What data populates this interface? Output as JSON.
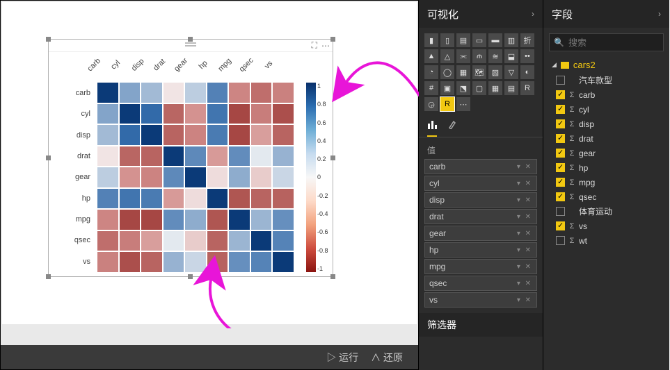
{
  "panes": {
    "viz_title": "可视化",
    "fields_title": "字段",
    "search_placeholder": "搜索",
    "values_label": "值",
    "filters_label": "筛选器"
  },
  "bottom_bar": {
    "run": "运行",
    "revert": "还原"
  },
  "table_name": "cars2",
  "value_items": [
    "carb",
    "cyl",
    "disp",
    "drat",
    "gear",
    "hp",
    "mpg",
    "qsec",
    "vs"
  ],
  "fields": [
    {
      "label": "汽车款型",
      "checked": false,
      "sigma": false
    },
    {
      "label": "carb",
      "checked": true,
      "sigma": true
    },
    {
      "label": "cyl",
      "checked": true,
      "sigma": true
    },
    {
      "label": "disp",
      "checked": true,
      "sigma": true
    },
    {
      "label": "drat",
      "checked": true,
      "sigma": true
    },
    {
      "label": "gear",
      "checked": true,
      "sigma": true
    },
    {
      "label": "hp",
      "checked": true,
      "sigma": true
    },
    {
      "label": "mpg",
      "checked": true,
      "sigma": true
    },
    {
      "label": "qsec",
      "checked": true,
      "sigma": true
    },
    {
      "label": "体育运动",
      "checked": false,
      "sigma": false
    },
    {
      "label": "vs",
      "checked": true,
      "sigma": true
    },
    {
      "label": "wt",
      "checked": false,
      "sigma": true
    }
  ],
  "chart_data": {
    "type": "heatmap",
    "title": "",
    "x_categories": [
      "carb",
      "cyl",
      "disp",
      "drat",
      "gear",
      "hp",
      "mpg",
      "qsec",
      "vs"
    ],
    "y_categories": [
      "carb",
      "cyl",
      "disp",
      "drat",
      "gear",
      "hp",
      "mpg",
      "qsec",
      "vs"
    ],
    "zlim": [
      -1,
      1
    ],
    "colorbar_ticks": [
      "1",
      "0.8",
      "0.6",
      "0.4",
      "0.2",
      "0",
      "-0.2",
      "-0.4",
      "-0.6",
      "-0.8",
      "-1"
    ],
    "matrix": [
      [
        1.0,
        0.53,
        0.39,
        -0.09,
        0.27,
        0.75,
        -0.55,
        -0.66,
        -0.57
      ],
      [
        0.53,
        1.0,
        0.9,
        -0.7,
        -0.49,
        0.83,
        -0.85,
        -0.59,
        -0.81
      ],
      [
        0.39,
        0.9,
        1.0,
        -0.71,
        -0.56,
        0.79,
        -0.85,
        -0.43,
        -0.71
      ],
      [
        -0.09,
        -0.7,
        -0.71,
        1.0,
        0.7,
        -0.45,
        0.68,
        0.09,
        0.44
      ],
      [
        0.27,
        -0.49,
        -0.56,
        0.7,
        1.0,
        -0.13,
        0.48,
        -0.21,
        0.21
      ],
      [
        0.75,
        0.83,
        0.79,
        -0.45,
        -0.13,
        1.0,
        -0.78,
        -0.71,
        -0.72
      ],
      [
        -0.55,
        -0.85,
        -0.85,
        0.68,
        0.48,
        -0.78,
        1.0,
        0.42,
        0.66
      ],
      [
        -0.66,
        -0.59,
        -0.43,
        0.09,
        -0.21,
        -0.71,
        0.42,
        1.0,
        0.74
      ],
      [
        -0.57,
        -0.81,
        -0.71,
        0.44,
        0.21,
        -0.72,
        0.66,
        0.74,
        1.0
      ]
    ]
  },
  "viz_icons": [
    "bar-stacked",
    "bar-clustered",
    "bar-100",
    "bar-h-stacked",
    "bar-h-clustered",
    "bar-h-100",
    "line",
    "area",
    "area-stacked",
    "line-bar",
    "line-bar2",
    "ribbon",
    "waterfall",
    "scatter",
    "pie",
    "donut",
    "treemap",
    "map",
    "filled-map",
    "funnel",
    "gauge",
    "card",
    "multi-card",
    "kpi",
    "slicer",
    "table",
    "matrix",
    "r-visual",
    "arcgis",
    "r-script-visual",
    "more"
  ],
  "selected_viz_icon": 29
}
